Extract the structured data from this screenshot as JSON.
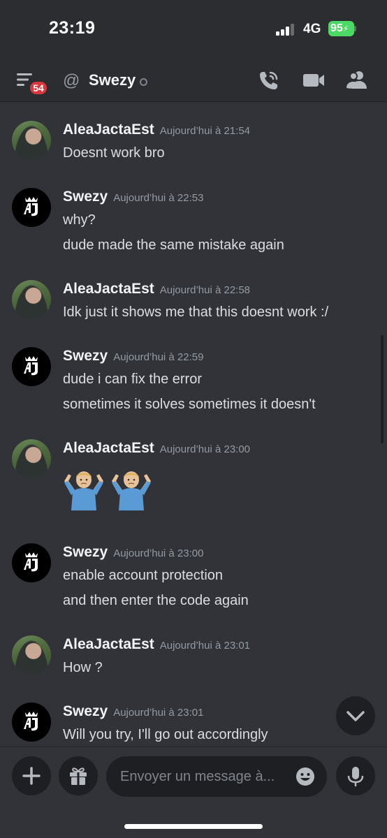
{
  "status_bar": {
    "time": "23:19",
    "network": "4G",
    "battery": "95"
  },
  "header": {
    "notification_count": "54",
    "at_symbol": "@",
    "channel_name": "Swezy"
  },
  "messages": [
    {
      "author": "AleaJactaEst",
      "timestamp": "Aujourd’hui à 21:54",
      "avatar": "user-photo",
      "lines": [
        "Doesnt work bro"
      ]
    },
    {
      "author": "Swezy",
      "timestamp": "Aujourd’hui à 22:53",
      "avatar": "aj-crown-logo",
      "lines": [
        "why?",
        "dude made the same mistake again"
      ]
    },
    {
      "author": "AleaJactaEst",
      "timestamp": "Aujourd’hui à 22:58",
      "avatar": "user-photo",
      "lines": [
        "Idk just it shows me that this doesnt work :/"
      ]
    },
    {
      "author": "Swezy",
      "timestamp": "Aujourd’hui à 22:59",
      "avatar": "aj-crown-logo",
      "lines": [
        "dude i can fix the error",
        "sometimes it solves sometimes it doesn't"
      ]
    },
    {
      "author": "AleaJactaEst",
      "timestamp": "Aujourd’hui à 23:00",
      "avatar": "user-photo",
      "emojis": [
        "person-shrugging",
        "person-shrugging"
      ]
    },
    {
      "author": "Swezy",
      "timestamp": "Aujourd’hui à 23:00",
      "avatar": "aj-crown-logo",
      "lines": [
        "enable account protection",
        "and then enter the code again"
      ]
    },
    {
      "author": "AleaJactaEst",
      "timestamp": "Aujourd’hui à 23:01",
      "avatar": "user-photo",
      "lines": [
        "How ?"
      ]
    },
    {
      "author": "Swezy",
      "timestamp": "Aujourd’hui à 23:01",
      "avatar": "aj-crown-logo",
      "lines": [
        "Will you try, I'll go out accordingly"
      ]
    }
  ],
  "composer": {
    "placeholder": "Envoyer un message à..."
  },
  "icons": {
    "header": [
      "menu-icon",
      "at-icon",
      "phone-call-icon",
      "video-camera-icon",
      "members-icon"
    ],
    "composer": [
      "plus-icon",
      "gift-icon",
      "emoji-icon",
      "microphone-icon"
    ],
    "other": [
      "chevron-down-icon"
    ]
  },
  "colors": {
    "background": "#313338",
    "header_background": "#2b2d31",
    "input_background": "#1e1f22",
    "badge_red": "#da373c",
    "battery_green": "#4cd864",
    "timestamp_gray": "#949ba4"
  }
}
